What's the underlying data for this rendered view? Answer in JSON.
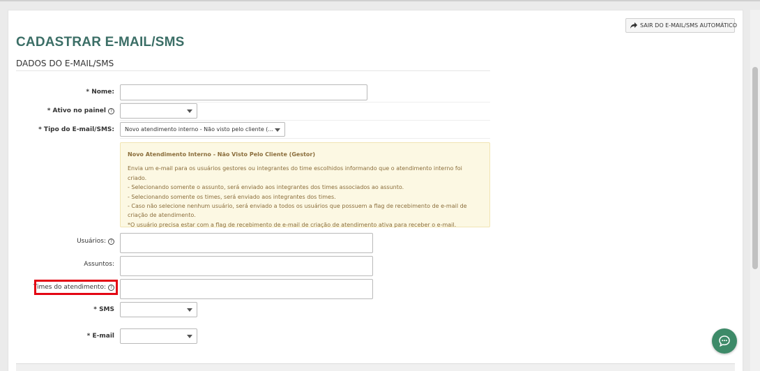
{
  "header": {
    "exit_button_label": "SAIR DO E-MAIL/SMS AUTOMÁTICO",
    "page_title": "CADASTRAR E-MAIL/SMS",
    "section_title": "DADOS DO E-MAIL/SMS"
  },
  "form": {
    "nome": {
      "label": "* Nome:",
      "value": ""
    },
    "ativo": {
      "label": "* Ativo no painel",
      "value": ""
    },
    "tipo": {
      "label": "* Tipo do E-mail/SMS:",
      "value": "Novo atendimento interno - Não visto pelo cliente (..."
    },
    "usuarios": {
      "label": "Usuários:",
      "value": ""
    },
    "assuntos": {
      "label": "Assuntos:",
      "value": ""
    },
    "times": {
      "label": "Times do atendimento:",
      "value": ""
    },
    "sms": {
      "label": "* SMS",
      "value": ""
    },
    "email": {
      "label": "* E-mail",
      "value": ""
    }
  },
  "info": {
    "heading": "Novo Atendimento Interno - Não Visto Pelo Cliente (Gestor)",
    "lines": [
      "Envia um e-mail para os usuários gestores ou integrantes do time escolhidos informando que o atendimento interno foi criado.",
      "- Selecionando somente o assunto, será enviado aos integrantes dos times associados ao assunto.",
      "- Selecionando somente os times, será enviado aos integrantes dos times.",
      "- Caso não selecione nenhum usuário, será enviado a todos os usuários que possuem a flag de recebimento de e-mail de",
      "criação de atendimento.",
      "*O usuário precisa estar com a flag de recebimento de e-mail de criação de atendimento ativa para receber o e-mail."
    ]
  },
  "help_glyph": "?",
  "icons": {
    "exit": "share-arrow-icon",
    "help": "question-circle-icon",
    "chat": "chat-bubble-icon"
  },
  "colors": {
    "title": "#3b6e66",
    "highlight": "#e30613",
    "chat": "#3d8a68",
    "info_bg": "#fcf8e3",
    "info_text": "#8a6d3b"
  }
}
